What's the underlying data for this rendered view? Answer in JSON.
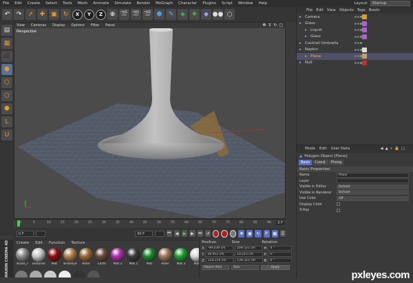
{
  "menubar": {
    "items": [
      "File",
      "Edit",
      "Create",
      "Select",
      "Tools",
      "Mesh",
      "Animate",
      "Simulate",
      "Render",
      "MoGraph",
      "Character",
      "Plugins",
      "Script",
      "Window",
      "Help"
    ],
    "layout_label": "Layout:",
    "layout_value": "Startup"
  },
  "toolbar": {
    "icons": [
      "undo-icon",
      "redo-icon",
      "live-selection-icon",
      "move-icon",
      "scale-icon",
      "rotate-icon",
      "x-axis-icon",
      "y-axis-icon",
      "z-axis-icon",
      "world-coordinates-icon",
      "render-view-icon",
      "render-settings-icon",
      "render-picture-viewer-icon",
      "cube-icon",
      "pen-icon",
      "subdivision-icon",
      "array-icon",
      "deformer-icon",
      "camera-icon",
      "light-icon"
    ],
    "axis_labels": [
      "X",
      "Y",
      "Z"
    ]
  },
  "viewport": {
    "menu": [
      "View",
      "Cameras",
      "Display",
      "Options",
      "Filter",
      "Panel"
    ],
    "label": "Perspective"
  },
  "timeline": {
    "ticks": [
      "0",
      "5",
      "10",
      "15",
      "20",
      "25",
      "30",
      "35",
      "40",
      "45",
      "50",
      "55",
      "60",
      "65",
      "70",
      "75",
      "80",
      "85",
      "90"
    ],
    "end_label": "0 F",
    "start_field": "0 F",
    "end_field": "90 F",
    "current_field": "0 F"
  },
  "materials": {
    "menu": [
      "Create",
      "Edit",
      "Function",
      "Texture"
    ],
    "items": [
      {
        "label": "Knots_F",
        "color": "#8a8a8a"
      },
      {
        "label": "Textured",
        "color": "#c8c8c8"
      },
      {
        "label": "Mat",
        "color": "#8a1010"
      },
      {
        "label": "Birdseye",
        "color": "#b08050"
      },
      {
        "label": "Alder",
        "color": "#9a6a3a"
      },
      {
        "label": "Earth",
        "color": "#6a4a3a"
      },
      {
        "label": "Mat.2",
        "color": "#b030b0"
      },
      {
        "label": "Mat.1",
        "color": "#3a3a3a"
      },
      {
        "label": "Mat",
        "color": "#1a8a2a"
      },
      {
        "label": "Alder",
        "color": "#a07a5a"
      },
      {
        "label": "Mat.3",
        "color": "#20a030"
      },
      {
        "label": "Mat",
        "color": "#d8d8d8"
      }
    ],
    "logo": "MAXON CINEMA 4D"
  },
  "coordinates": {
    "headers": [
      "Position",
      "Size",
      "Rotation"
    ],
    "rows": [
      {
        "axis": "X",
        "pos": "-99.039 cm",
        "size": "209.531 cm",
        "rot_axis": "H",
        "rot": "0 °"
      },
      {
        "axis": "Y",
        "pos": "26.952 cm",
        "size": "10.215 cm",
        "rot_axis": "P",
        "rot": "0 °"
      },
      {
        "axis": "Z",
        "pos": "124.376 cm",
        "size": "139.315 cm",
        "rot_axis": "B",
        "rot": "0 °"
      }
    ],
    "mode": "Object (Rel)",
    "size_mode": "Size",
    "apply": "Apply"
  },
  "objects": {
    "menu": [
      "File",
      "Edit",
      "View",
      "Objects",
      "Tags",
      "Bookr"
    ],
    "items": [
      {
        "name": "Camera",
        "indent": 0,
        "selected": false
      },
      {
        "name": "Glass",
        "indent": 0,
        "selected": false
      },
      {
        "name": "Liquid",
        "indent": 1,
        "selected": false
      },
      {
        "name": "Glass",
        "indent": 1,
        "selected": false
      },
      {
        "name": "Cocktail Umbrella",
        "indent": 0,
        "selected": false
      },
      {
        "name": "Napkin",
        "indent": 0,
        "selected": false
      },
      {
        "name": "Plane",
        "indent": 1,
        "selected": true
      },
      {
        "name": "Null",
        "indent": 0,
        "selected": false
      }
    ]
  },
  "attributes": {
    "menu": [
      "Mode",
      "Edit",
      "User Data"
    ],
    "title": "Polygon Object [Plane]",
    "tabs": [
      "Basic",
      "Coord.",
      "Phong"
    ],
    "section": "Basic Properties",
    "props": [
      {
        "label": "Name",
        "value": "Plane"
      },
      {
        "label": "Layer",
        "value": ""
      },
      {
        "label": "Visible in Editor",
        "value": "Default"
      },
      {
        "label": "Visible in Renderer",
        "value": "Default"
      },
      {
        "label": "Use Color",
        "value": "Off"
      },
      {
        "label": "Display Color",
        "value": ""
      },
      {
        "label": "X-Ray",
        "value": ""
      }
    ]
  },
  "watermark": "pxleyes.com"
}
